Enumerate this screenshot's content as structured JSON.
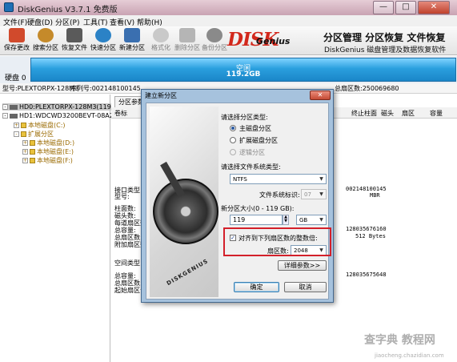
{
  "window": {
    "title": "DiskGenius V3.7.1 免费版",
    "min": "—",
    "max": "□",
    "close": "✕"
  },
  "menu": [
    "文件(F)",
    "硬盘(D)",
    "分区(P)",
    "工具(T)",
    "查看(V)",
    "帮助(H)"
  ],
  "toolbar": [
    {
      "label": "保存更改",
      "icon": "save-icon",
      "color": "#d14a2c"
    },
    {
      "label": "搜索分区",
      "icon": "search-partition-icon",
      "color": "#c58a2a"
    },
    {
      "label": "恢复文件",
      "icon": "recover-file-icon",
      "color": "#5a5a5a"
    },
    {
      "label": "快速分区",
      "icon": "quick-partition-icon",
      "color": "#2b82c6"
    },
    {
      "label": "新建分区",
      "icon": "new-partition-icon",
      "color": "#3a6fb0"
    },
    {
      "label": "格式化",
      "icon": "format-icon",
      "color": "#9a9a9a"
    },
    {
      "label": "删除分区",
      "icon": "delete-partition-icon",
      "color": "#8f8f8f"
    },
    {
      "label": "备份分区",
      "icon": "backup-partition-icon",
      "color": "#6a6a6a"
    }
  ],
  "brand": {
    "logo_big": "DISK",
    "logo_small": "Genius",
    "slogan": "分区管理 分区恢复 文件恢复",
    "subslogan": "DiskGenius 磁盘管理及数据恢复软件"
  },
  "diskbar": {
    "disk_label": "硬盘 0",
    "free_label": "空闲",
    "free_size": "119.2GB"
  },
  "infobar": {
    "model": "型号:PLEXTORPX-128M3",
    "serial": "序列号:002148100145",
    "sectors": "总扇区数:250069680"
  },
  "tree": [
    {
      "text": "HD0:PLEXTORPX-128M3(119GB)",
      "kind": "disk",
      "selected": true
    },
    {
      "text": "HD1:WDCWD3200BEVT-08A23T1",
      "kind": "disk",
      "selected": false
    },
    {
      "text": "本地磁盘(C:)",
      "kind": "part"
    },
    {
      "text": "扩展分区",
      "kind": "ext"
    },
    {
      "text": "本地磁盘(D:)",
      "kind": "part"
    },
    {
      "text": "本地磁盘(E:)",
      "kind": "part"
    },
    {
      "text": "本地磁盘(F:)",
      "kind": "part"
    }
  ],
  "right": {
    "tab": "分区参数",
    "columns": [
      "卷标",
      "终止柱面",
      "磁头",
      "扇区",
      "容量"
    ],
    "labels": {
      "iface": "接口类型",
      "model": "型号:",
      "cyl": "柱面数:",
      "heads": "磁头数:",
      "spt": "每道扇区数",
      "cap": "总容量:",
      "sectors": "总扇区数:",
      "extra": "附加扇区数",
      "free_type": "空间类型",
      "free_cap": "总容量:",
      "free_sec": "总扇区数:",
      "start_sec": "起始扇区号"
    },
    "values": {
      "serial": "002148100145",
      "mbr": "MBR",
      "bytes_total": "128035676160",
      "sector_size": "512 Bytes",
      "bytes_free": "128035675648"
    }
  },
  "dialog": {
    "title": "建立新分区",
    "close": "✕",
    "art_brand": "DISKGENIUS",
    "type_label": "请选择分区类型:",
    "types": [
      "主磁盘分区",
      "扩展磁盘分区",
      "逻辑分区"
    ],
    "selected_type": 0,
    "fs_label": "请选择文件系统类型:",
    "fs_value": "NTFS",
    "fs_id_label": "文件系统标识:",
    "fs_id_value": "07",
    "size_label": "新分区大小(0 - 119 GB):",
    "size_value": "119",
    "size_unit": "GB",
    "align_label": "对齐到下列扇区数的整数倍:",
    "align_checked": true,
    "sector_label": "扇区数:",
    "sector_value": "2048",
    "detail_button": "详细参数>>",
    "ok_button": "确定",
    "cancel_button": "取消"
  },
  "watermark": {
    "line1": "查字典 教程网",
    "line2": "jiaocheng.chazidian.com"
  }
}
